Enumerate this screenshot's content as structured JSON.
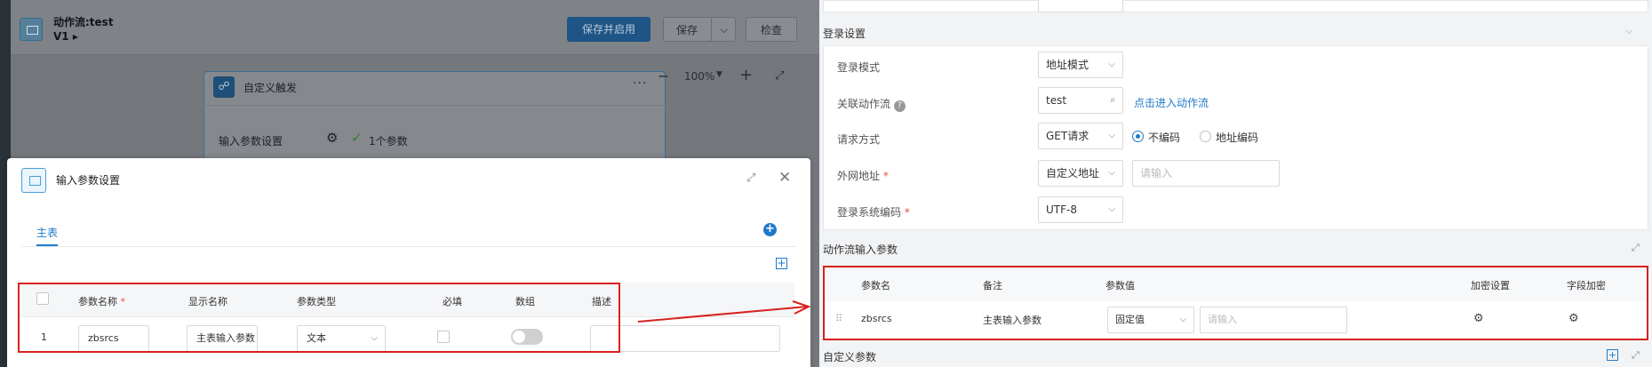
{
  "workflow": {
    "title": "动作流:test",
    "version": "V1 ▸",
    "save_enable_label": "保存并启用",
    "save_label": "保存",
    "save_caret": "⌵",
    "check_label": "检查"
  },
  "canvas": {
    "node_title": "自定义触发",
    "node_more": "···",
    "input_param_label": "输入参数设置",
    "param_count": "1个参数",
    "zoom": "100%",
    "zoom_minus": "−",
    "zoom_plus": "+"
  },
  "modal": {
    "title": "输入参数设置",
    "tab_main": "主表",
    "columns": {
      "name": "参数名称",
      "display": "显示名称",
      "type": "参数类型",
      "required": "必填",
      "array": "数组",
      "desc": "描述"
    },
    "row": {
      "index": "1",
      "name": "zbsrcs",
      "display": "主表输入参数",
      "type": "文本"
    }
  },
  "right": {
    "login": {
      "section_title": "登录设置",
      "mode_label": "登录模式",
      "mode_value": "地址模式",
      "flow_label": "关联动作流",
      "flow_value": "test",
      "flow_link": "点击进入动作流",
      "method_label": "请求方式",
      "method_value": "GET请求",
      "radio_no_encode": "不编码",
      "radio_addr_encode": "地址编码",
      "url_label": "外网地址",
      "url_mode": "自定义地址",
      "url_placeholder": "请输入",
      "encoding_label": "登录系统编码",
      "encoding_value": "UTF-8"
    },
    "input_params": {
      "section_title": "动作流输入参数",
      "columns": {
        "name": "参数名",
        "note": "备注",
        "value": "参数值",
        "encrypt": "加密设置",
        "field_encrypt": "字段加密"
      },
      "row": {
        "name": "zbsrcs",
        "note": "主表输入参数",
        "value_type": "固定值",
        "value_placeholder": "请输入"
      }
    },
    "custom_params_title": "自定义参数"
  },
  "colors": {
    "primary": "#1f7ac9",
    "highlight": "#d6221f",
    "required_star": "#e84c3d"
  }
}
